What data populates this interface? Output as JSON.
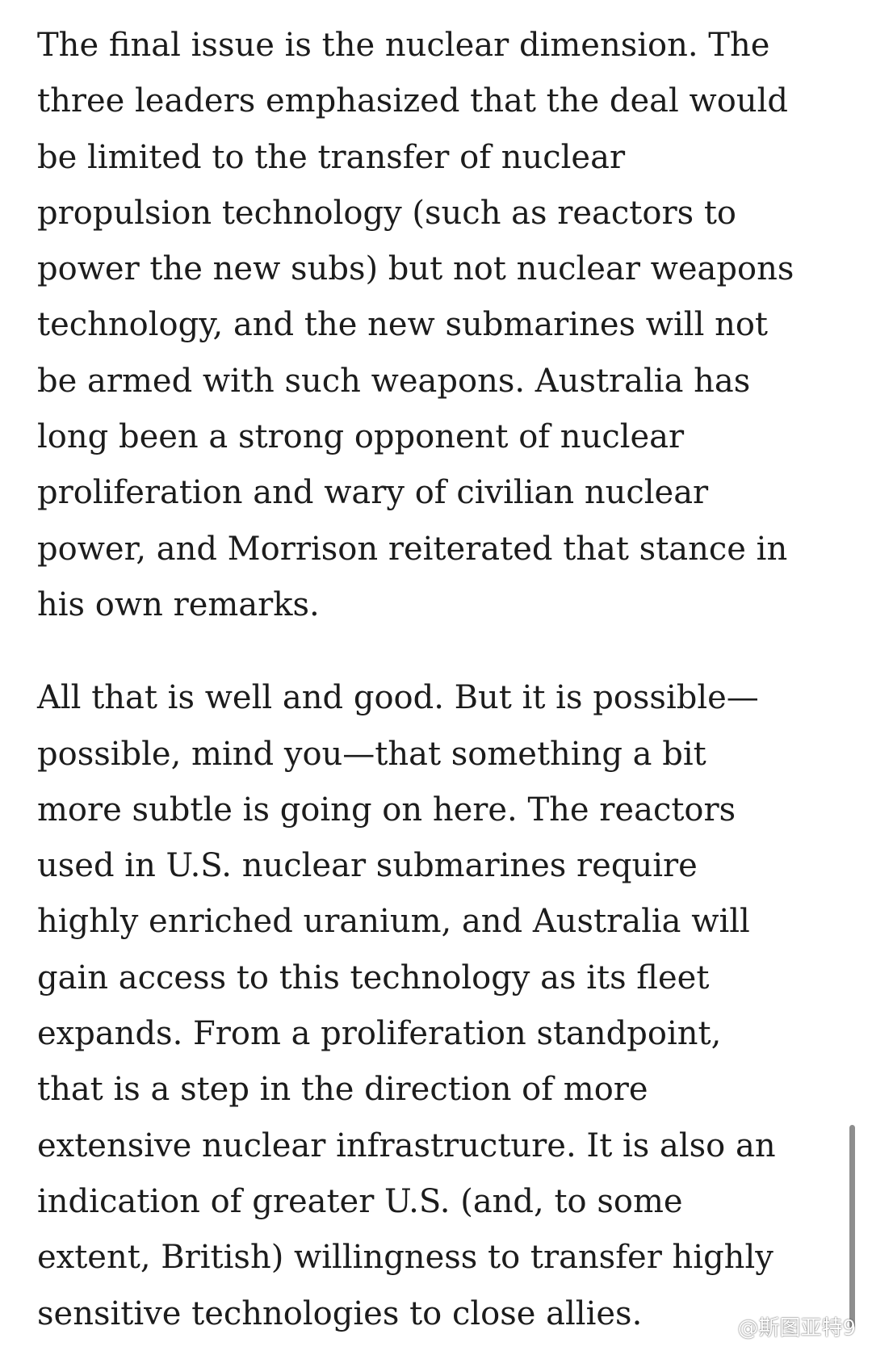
{
  "article": {
    "paragraphs": [
      "The final issue is the nuclear dimension. The\nthree leaders emphasized that the deal would\nbe limited to the transfer of nuclear\npropulsion technology (such as reactors to\npower the new subs) but not nuclear weapons\ntechnology, and the new submarines will not\nbe armed with such weapons. Australia has\nlong been a strong opponent of nuclear\nproliferation and wary of civilian nuclear\npower, and Morrison reiterated that stance in\nhis own remarks.",
      "All that is well and good. But it is possible—\npossible, mind you—that something a bit\nmore subtle is going on here. The reactors\nused in U.S. nuclear submarines require\nhighly enriched uranium, and Australia will\ngain access to this technology as its fleet\nexpands. From a proliferation standpoint,\nthat is a step in the direction of more\nextensive nuclear infrastructure. It is also an\nindication of greater U.S. (and, to some\nextent, British) willingness to transfer highly\nsensitive technologies to close allies."
    ]
  },
  "watermark": {
    "text": "@斯图亚特9",
    "icon": "weibo-icon"
  },
  "colors": {
    "text": "#1c1c1c",
    "background": "#ffffff",
    "scrollbar": "#8e8e8e"
  }
}
